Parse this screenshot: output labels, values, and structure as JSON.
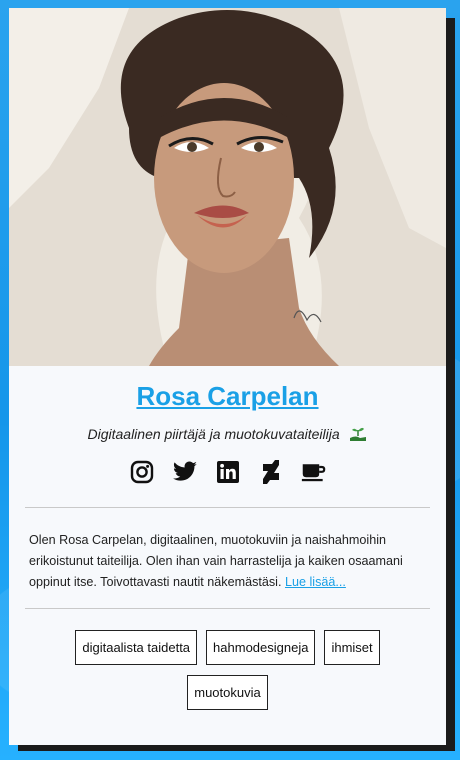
{
  "profile": {
    "name": "Rosa Carpelan",
    "subtitle": "Digitaalinen piirtäjä ja muotokuvataiteilija",
    "bio": "Olen Rosa Carpelan, digitaalinen, muotokuviin ja naishahmoihin erikoistunut taiteilija. Olen ihan vain harrastelija ja kaiken osaamani oppinut itse. Toivottavasti nautit näkemästäsi.",
    "read_more": "Lue lisää..."
  },
  "socials": [
    {
      "icon": "instagram-icon"
    },
    {
      "icon": "twitter-icon"
    },
    {
      "icon": "linkedin-icon"
    },
    {
      "icon": "deviantart-icon"
    },
    {
      "icon": "coffee-icon"
    }
  ],
  "tags": [
    "digitaalista taidetta",
    "hahmodesigneja",
    "ihmiset",
    "muotokuvia"
  ],
  "colors": {
    "accent": "#1aa0e6",
    "background": "#1596ea",
    "card": "#f7f9fc",
    "shadow": "#1b1b1b"
  }
}
